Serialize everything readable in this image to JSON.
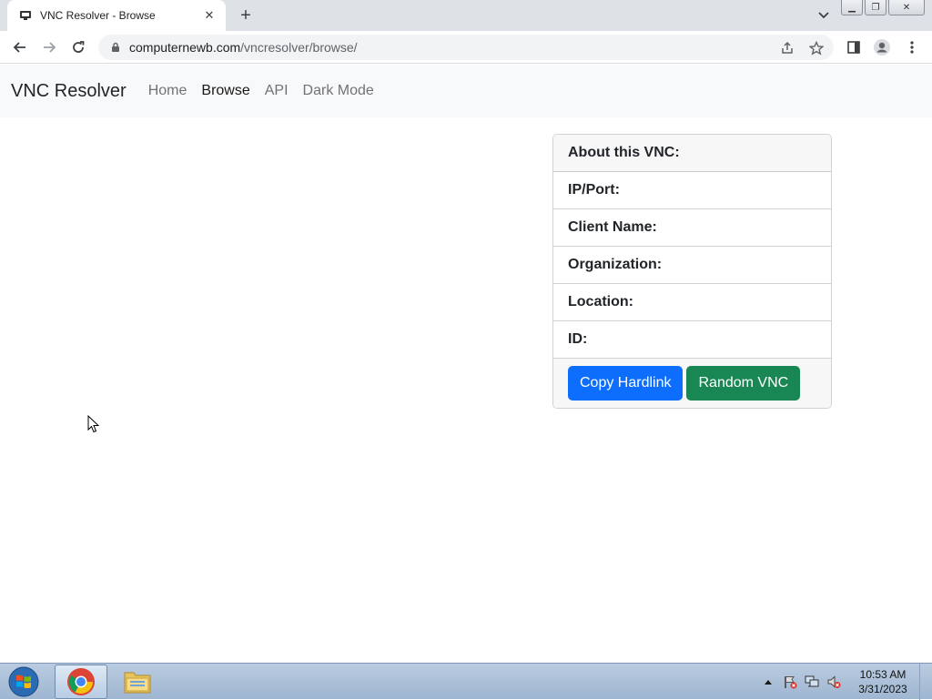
{
  "browser": {
    "tab_title": "VNC Resolver - Browse",
    "url_domain": "computernewb.com",
    "url_path": "/vncresolver/browse/"
  },
  "site": {
    "brand": "VNC Resolver",
    "nav": [
      "Home",
      "Browse",
      "API",
      "Dark Mode"
    ],
    "active_nav": "Browse"
  },
  "card": {
    "header": "About this VNC:",
    "fields": [
      "IP/Port:",
      "Client Name:",
      "Organization:",
      "Location:",
      "ID:"
    ],
    "copy_button": "Copy Hardlink",
    "random_button": "Random VNC"
  },
  "taskbar": {
    "time": "10:53 AM",
    "date": "3/31/2023"
  },
  "colors": {
    "primary": "#0d6efd",
    "success": "#198754",
    "navbar_bg": "#f8f9fa"
  }
}
